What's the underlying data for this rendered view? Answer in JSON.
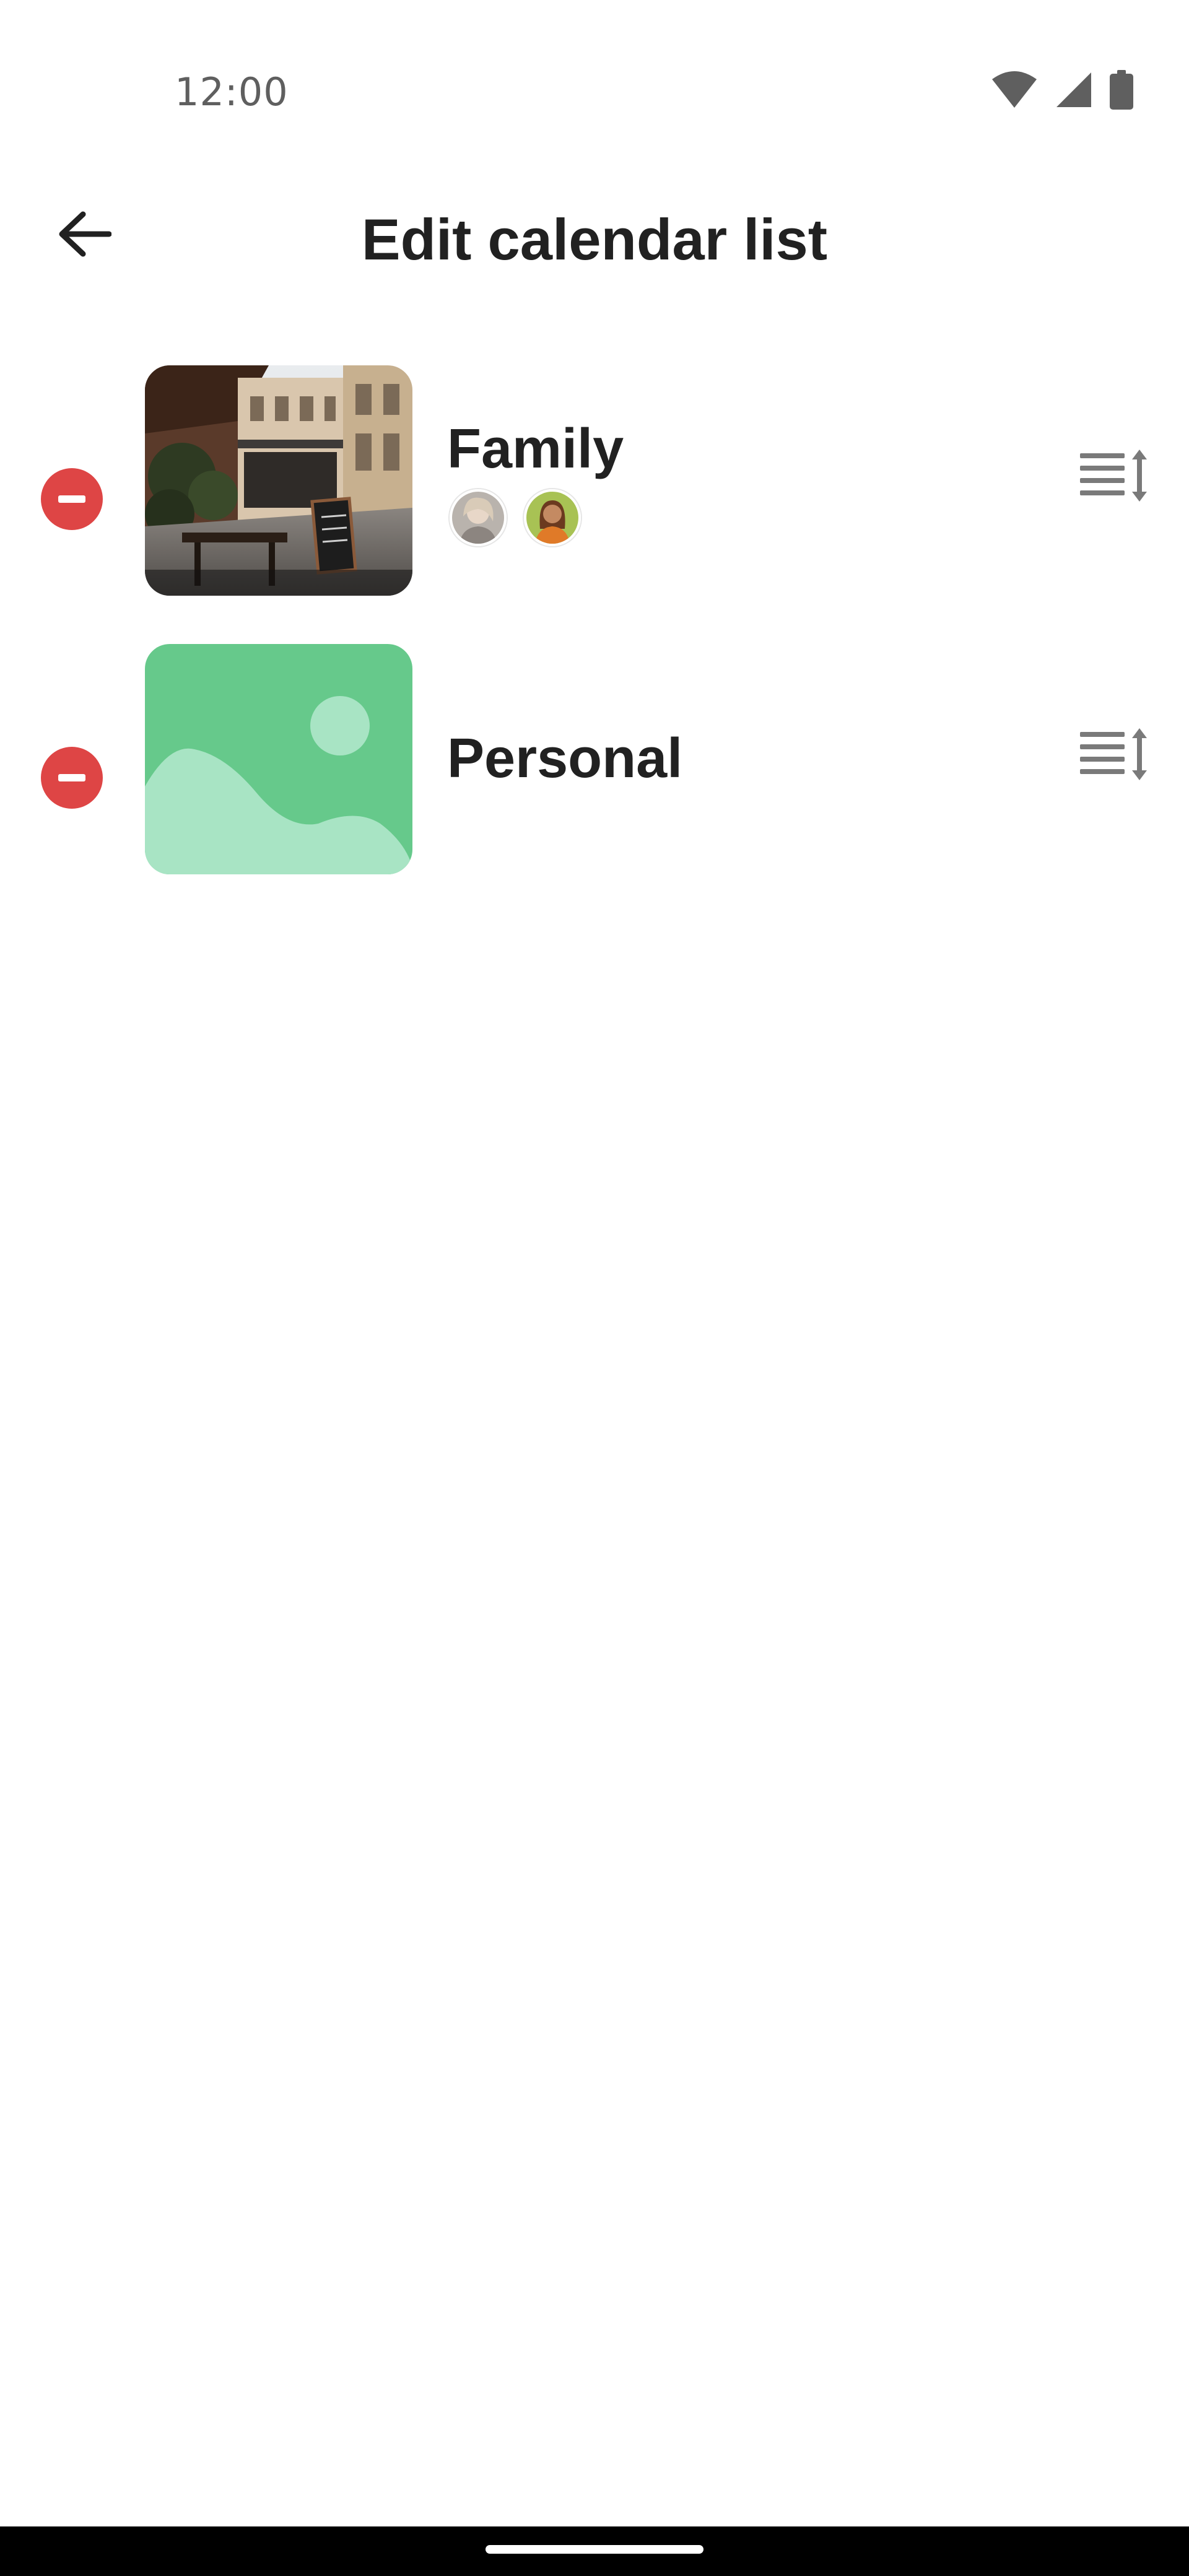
{
  "status_bar": {
    "time": "12:00",
    "icons": [
      "wifi-icon",
      "cellular-signal-icon",
      "battery-icon"
    ]
  },
  "header": {
    "title": "Edit calendar list",
    "back_icon": "arrow-back-icon"
  },
  "calendars": [
    {
      "name": "Family",
      "thumbnail": "street-cafe-photo",
      "members": [
        "member-avatar-1",
        "member-avatar-2"
      ],
      "remove_icon": "remove-circle-icon",
      "reorder_icon": "reorder-icon"
    },
    {
      "name": "Personal",
      "thumbnail": "image-placeholder-icon",
      "members": [],
      "remove_icon": "remove-circle-icon",
      "reorder_icon": "reorder-icon"
    }
  ],
  "colors": {
    "remove": "#de4545",
    "placeholder_bg": "#66c98b",
    "placeholder_fg": "#a8e4c4",
    "icon_grey": "#7a7a7a",
    "title_text": "#212121",
    "nav_bar": "#000000"
  }
}
